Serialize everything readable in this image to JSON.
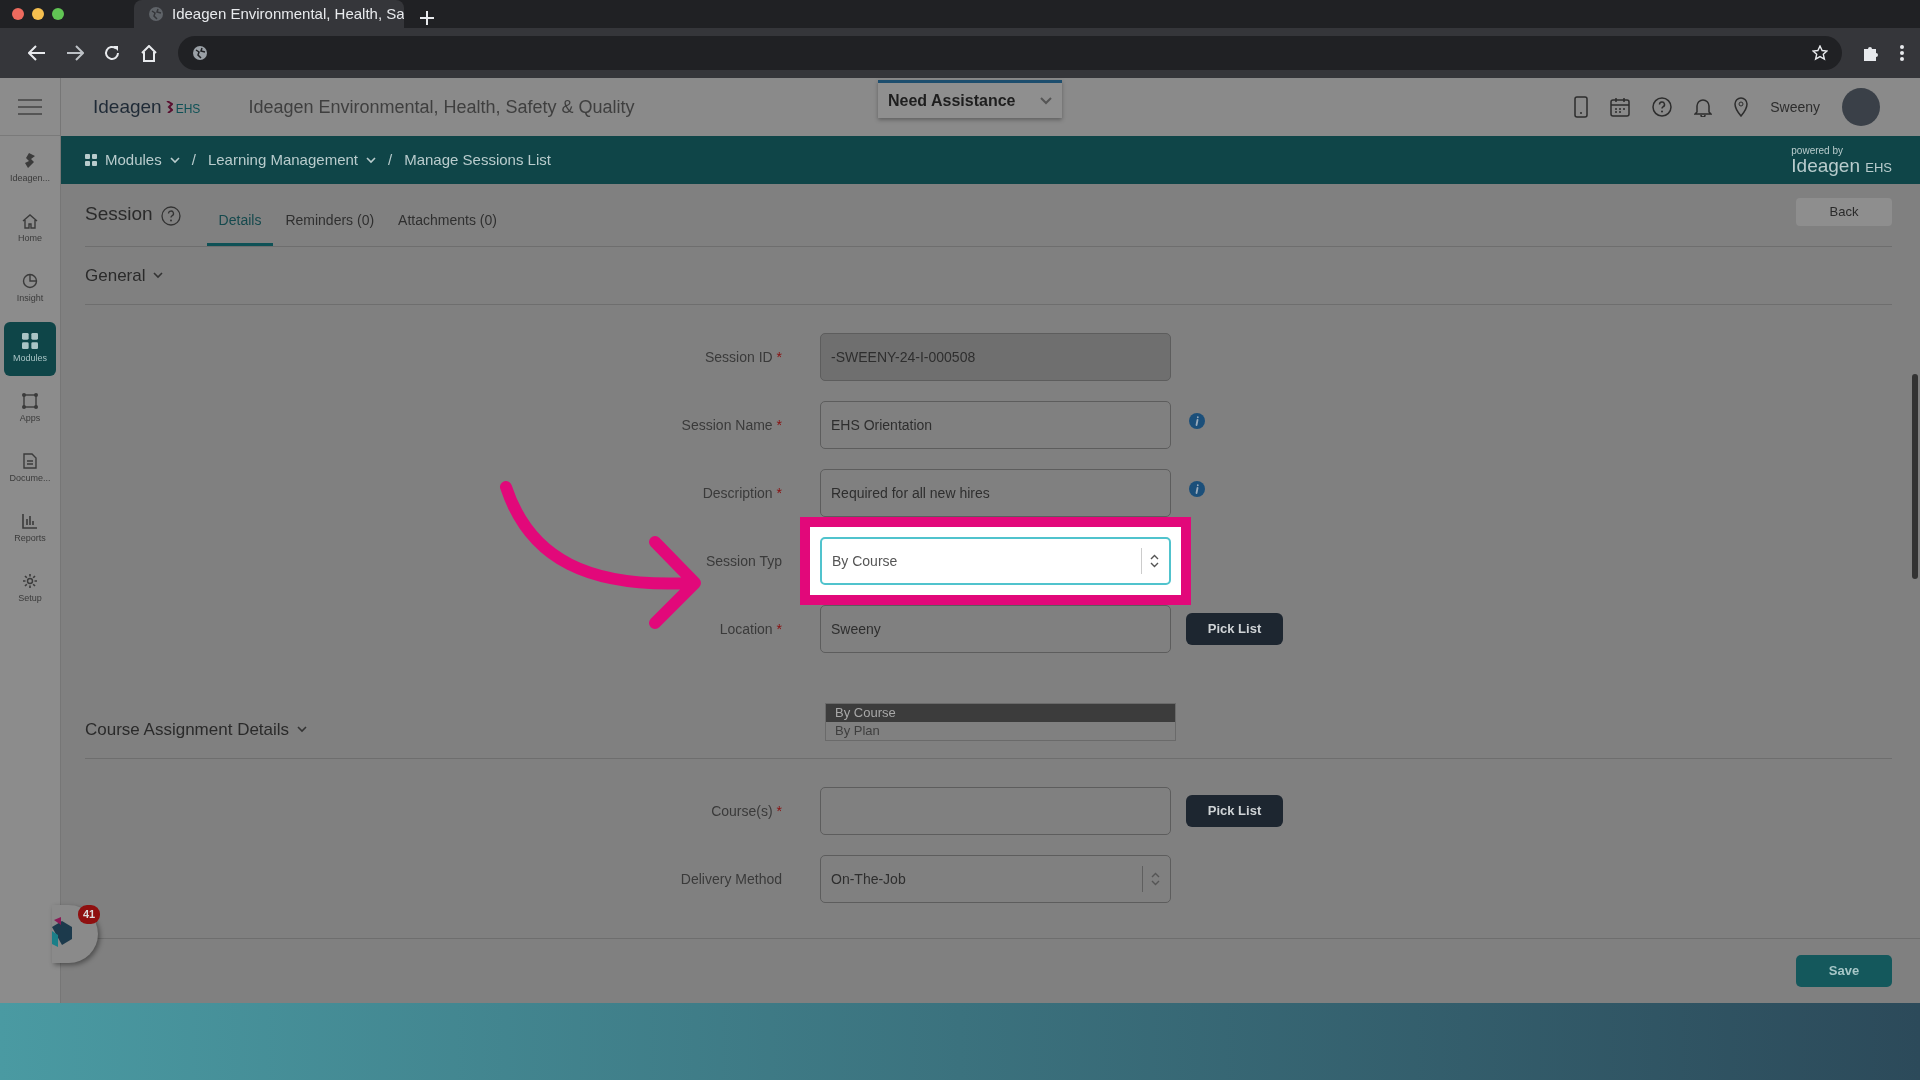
{
  "browser": {
    "tab_title": "Ideagen Environmental, Health, Sa"
  },
  "header": {
    "brand": "Ideagen",
    "brand_suffix": "EHS",
    "app_title": "Ideagen Environmental, Health, Safety & Quality",
    "assistance": "Need Assistance",
    "user": "Sweeny"
  },
  "breadcrumb": [
    {
      "label": "Modules",
      "has_menu": true,
      "kind": "modules"
    },
    {
      "separator": "/",
      "label": "Learning Management",
      "has_menu": true,
      "kind": "plain"
    },
    {
      "separator": "/",
      "label": "Manage Sessions List",
      "has_menu": false,
      "kind": "plain"
    }
  ],
  "powered_by": {
    "caption": "powered by",
    "brand": "Ideagen",
    "suffix": "EHS"
  },
  "sidebar": {
    "items": [
      {
        "label": "Ideagen...",
        "kind": "logo",
        "selected": false
      },
      {
        "label": "Home",
        "kind": "home",
        "selected": false
      },
      {
        "label": "Insight",
        "kind": "insight",
        "selected": false
      },
      {
        "label": "Modules",
        "kind": "modules",
        "selected": true
      },
      {
        "label": "Apps",
        "kind": "apps",
        "selected": false
      },
      {
        "label": "Docume...",
        "kind": "document",
        "selected": false
      },
      {
        "label": "Reports",
        "kind": "reports",
        "selected": false
      },
      {
        "label": "Setup",
        "kind": "setup",
        "selected": false
      }
    ]
  },
  "page": {
    "title": "Session",
    "back": "Back",
    "tabs": [
      {
        "label": "Details",
        "selected": true
      },
      {
        "label": "Reminders (0)",
        "selected": false
      },
      {
        "label": "Attachments (0)",
        "selected": false
      }
    ],
    "sections": [
      {
        "title": "General",
        "fields": [
          {
            "label": "Session ID",
            "required_mark": "*",
            "kind": "text",
            "value": "-SWEENY-24-I-000508",
            "disabled": true
          },
          {
            "label": "Session Name",
            "required_mark": "*",
            "kind": "text",
            "value": "EHS Orientation",
            "disabled": false,
            "info": true
          },
          {
            "label": "Description",
            "required_mark": "*",
            "kind": "text",
            "value": "Required for all new hires",
            "disabled": false,
            "info": true
          },
          {
            "label": "Session Typ",
            "kind": "select",
            "value": "By Course",
            "disabled": false,
            "highlighted": true,
            "options": [
              {
                "label": "By Course",
                "selected": true
              },
              {
                "label": "By Plan",
                "selected": false
              }
            ]
          },
          {
            "label": "Location",
            "required_mark": "*",
            "kind": "text",
            "value": "Sweeny",
            "disabled": false,
            "button": "Pick List"
          }
        ]
      },
      {
        "title": "Course Assignment Details",
        "fields": [
          {
            "label": "Course(s)",
            "required_mark": "*",
            "kind": "text",
            "disabled": false,
            "button": "Pick List"
          },
          {
            "label": "Delivery Method",
            "kind": "select",
            "value": "On-The-Job",
            "disabled": false
          }
        ]
      }
    ],
    "save": "Save"
  },
  "notification": {
    "count": "41"
  }
}
